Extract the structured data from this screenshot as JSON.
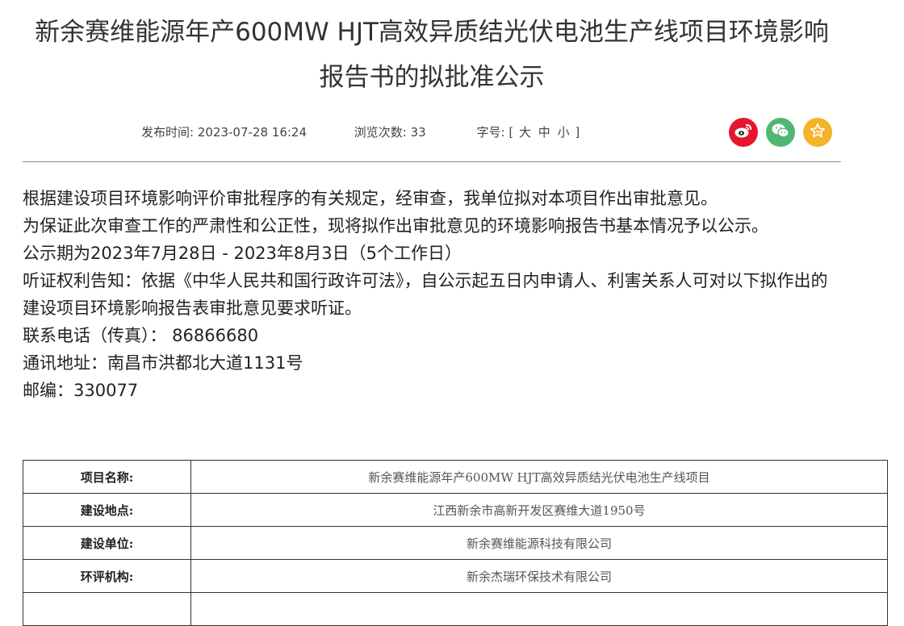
{
  "article": {
    "title_line1": "新余赛维能源年产600MW HJT高效异质结光伏电池生产线项目环境影响",
    "title_line2": "报告书的拟批准公示",
    "meta": {
      "publish_label": "发布时间:",
      "publish_time": "2023-07-28 16:24",
      "views_label": "浏览次数:",
      "views": "33",
      "font_label": "字号:",
      "bracket_open": "[",
      "font_large": "大",
      "font_medium": "中",
      "font_small": "小",
      "bracket_close": "]"
    },
    "share_icons": [
      "weibo-icon",
      "wechat-icon",
      "favorite-icon"
    ],
    "paragraphs": [
      "根据建设项目环境影响评价审批程序的有关规定，经审查，我单位拟对本项目作出审批意见。",
      "为保证此次审查工作的严肃性和公正性，现将拟作出审批意见的环境影响报告书基本情况予以公示。",
      "公示期为2023年7月28日 - 2023年8月3日（5个工作日）",
      "听证权利告知：依据《中华人民共和国行政许可法》，自公示起五日内申请人、利害关系人可对以下拟作出的建设项目环境影响报告表审批意见要求听证。",
      "联系电话（传真）： 86866680",
      "通讯地址：南昌市洪都北大道1131号",
      "邮编：330077"
    ],
    "table": {
      "rows": [
        {
          "label": "项目名称:",
          "value": "新余赛维能源年产600MW HJT高效异质结光伏电池生产线项目"
        },
        {
          "label": "建设地点:",
          "value": "江西新余市高新开发区赛维大道1950号"
        },
        {
          "label": "建设单位:",
          "value": "新余赛维能源科技有限公司"
        },
        {
          "label": "环评机构:",
          "value": "新余杰瑞环保技术有限公司"
        },
        {
          "label": "",
          "value": ""
        }
      ]
    },
    "colors": {
      "weibo": "#e6162d",
      "wechat": "#50b674",
      "favorite": "#f3b42a"
    }
  }
}
